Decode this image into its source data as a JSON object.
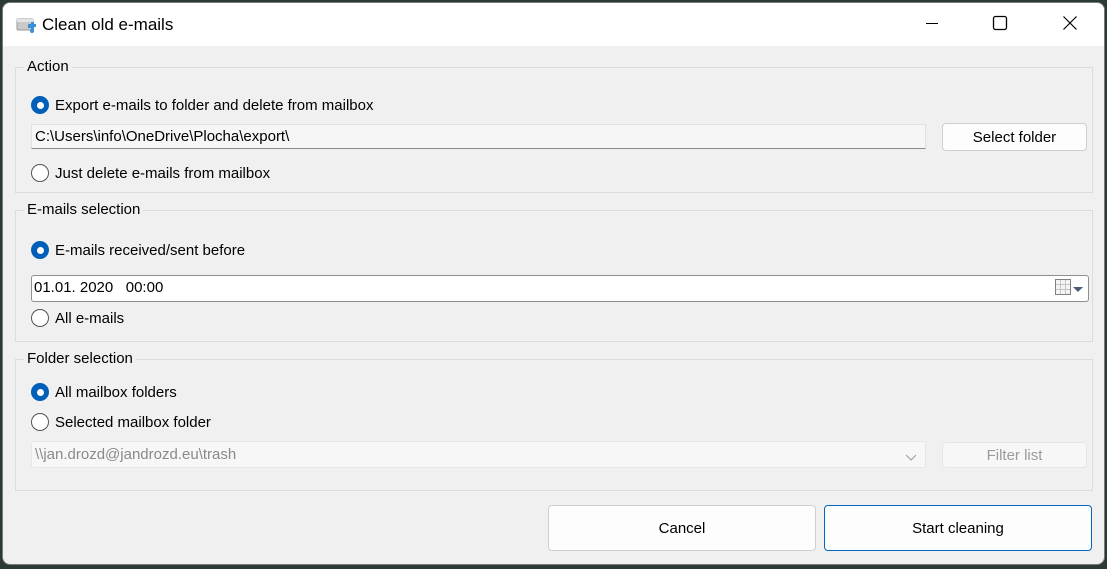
{
  "window": {
    "title": "Clean old e-mails",
    "controls": {
      "minimize": "minimize-icon",
      "maximize": "maximize-icon",
      "close": "close-icon"
    }
  },
  "action": {
    "label": "Action",
    "export_option": {
      "label": "Export e-mails to folder and delete from mailbox",
      "checked": true
    },
    "export_path": "C:\\Users\\info\\OneDrive\\Plocha\\export\\",
    "select_folder_label": "Select folder",
    "delete_option": {
      "label": "Just delete e-mails from mailbox",
      "checked": false
    }
  },
  "emails_selection": {
    "label": "E-mails selection",
    "before_option": {
      "label": "E-mails received/sent before",
      "checked": true
    },
    "date_value": "01.01. 2020   00:00",
    "calendar_icon": "calendar-icon",
    "all_option": {
      "label": "All e-mails",
      "checked": false
    }
  },
  "folder_selection": {
    "label": "Folder selection",
    "all_folders_option": {
      "label": "All mailbox folders",
      "checked": true
    },
    "selected_folder_option": {
      "label": "Selected mailbox folder",
      "checked": false
    },
    "folder_value": "\\\\jan.drozd@jandrozd.eu\\trash",
    "filter_list_label": "Filter list"
  },
  "footer": {
    "cancel_label": "Cancel",
    "start_label": "Start cleaning"
  },
  "colors": {
    "accent": "#005fb8",
    "window_bg": "#f0f0f0",
    "titlebar_bg": "#ffffff"
  }
}
